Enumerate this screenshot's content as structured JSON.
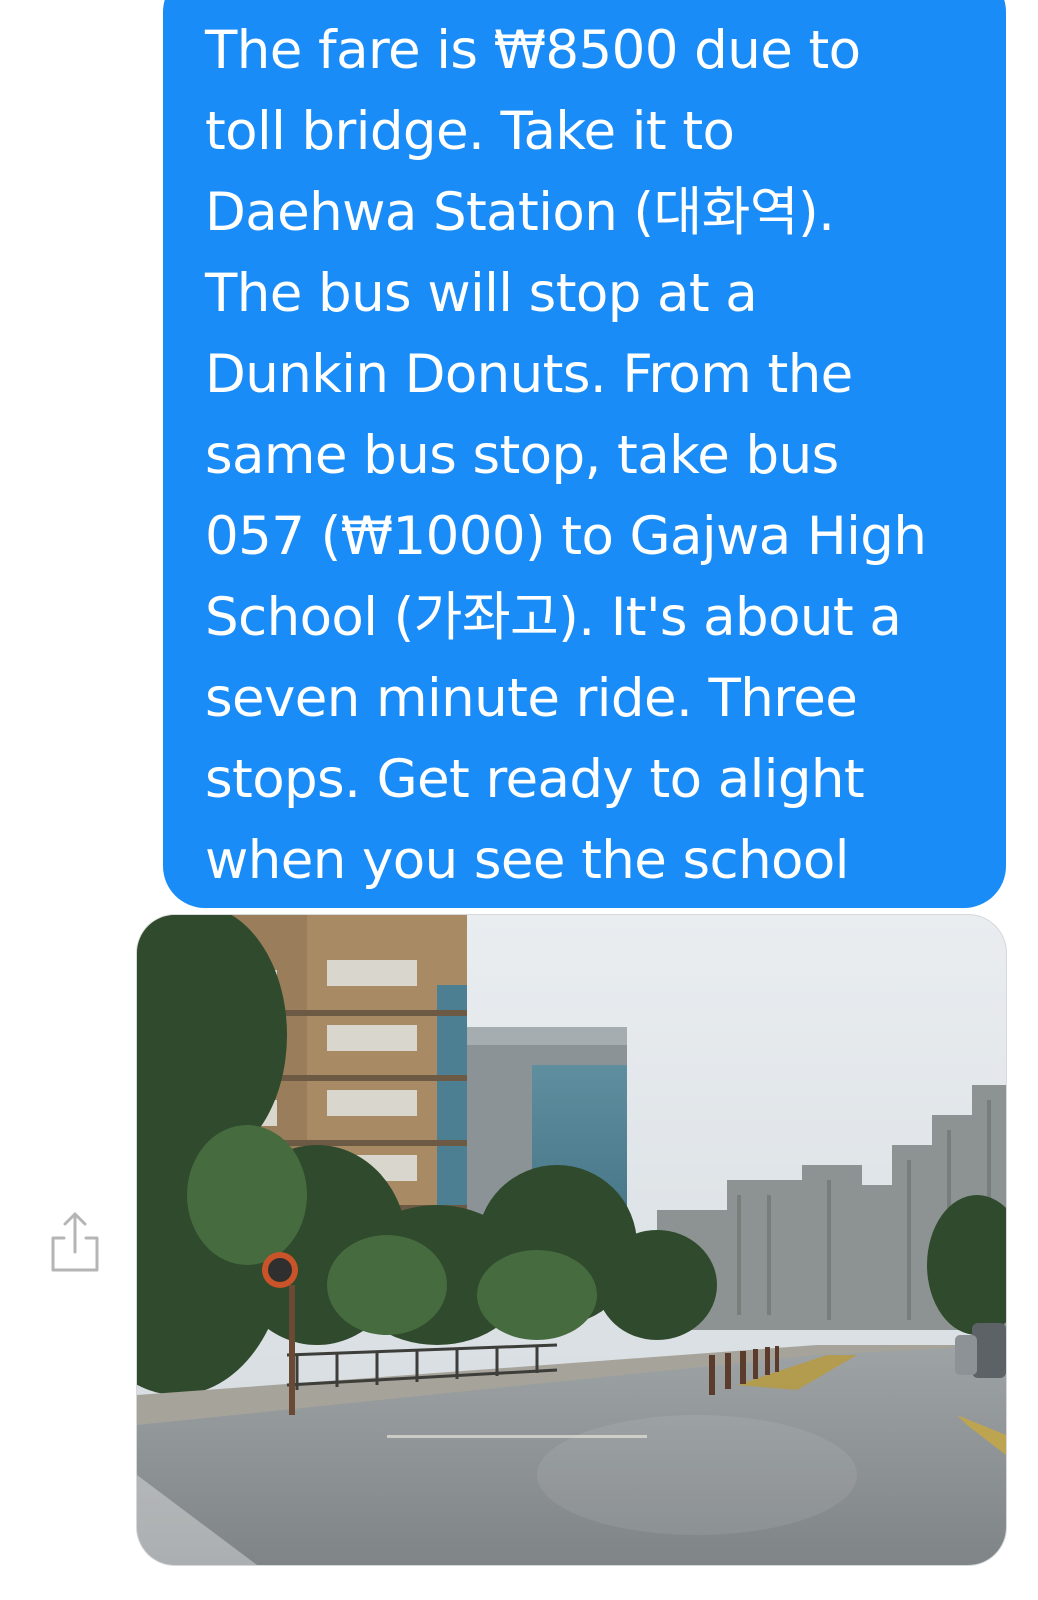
{
  "message": {
    "lines": [
      "The fare is ₩8500 due to",
      "toll bridge. Take it to",
      "Daehwa Station (대화역).",
      "The bus will stop at a",
      "Dunkin Donuts. From the",
      "same bus stop, take bus",
      "057 (₩1000) to Gajwa High",
      "School (가좌고). It's about a",
      "seven minute ride. Three",
      "stops. Get ready to alight",
      "when you see the school"
    ],
    "bubble_color": "#1a8cf7",
    "text_color": "#ffffff"
  },
  "attachment": {
    "type": "photo"
  },
  "share": {
    "icon": "share-icon",
    "color": "#b5b5b5"
  }
}
